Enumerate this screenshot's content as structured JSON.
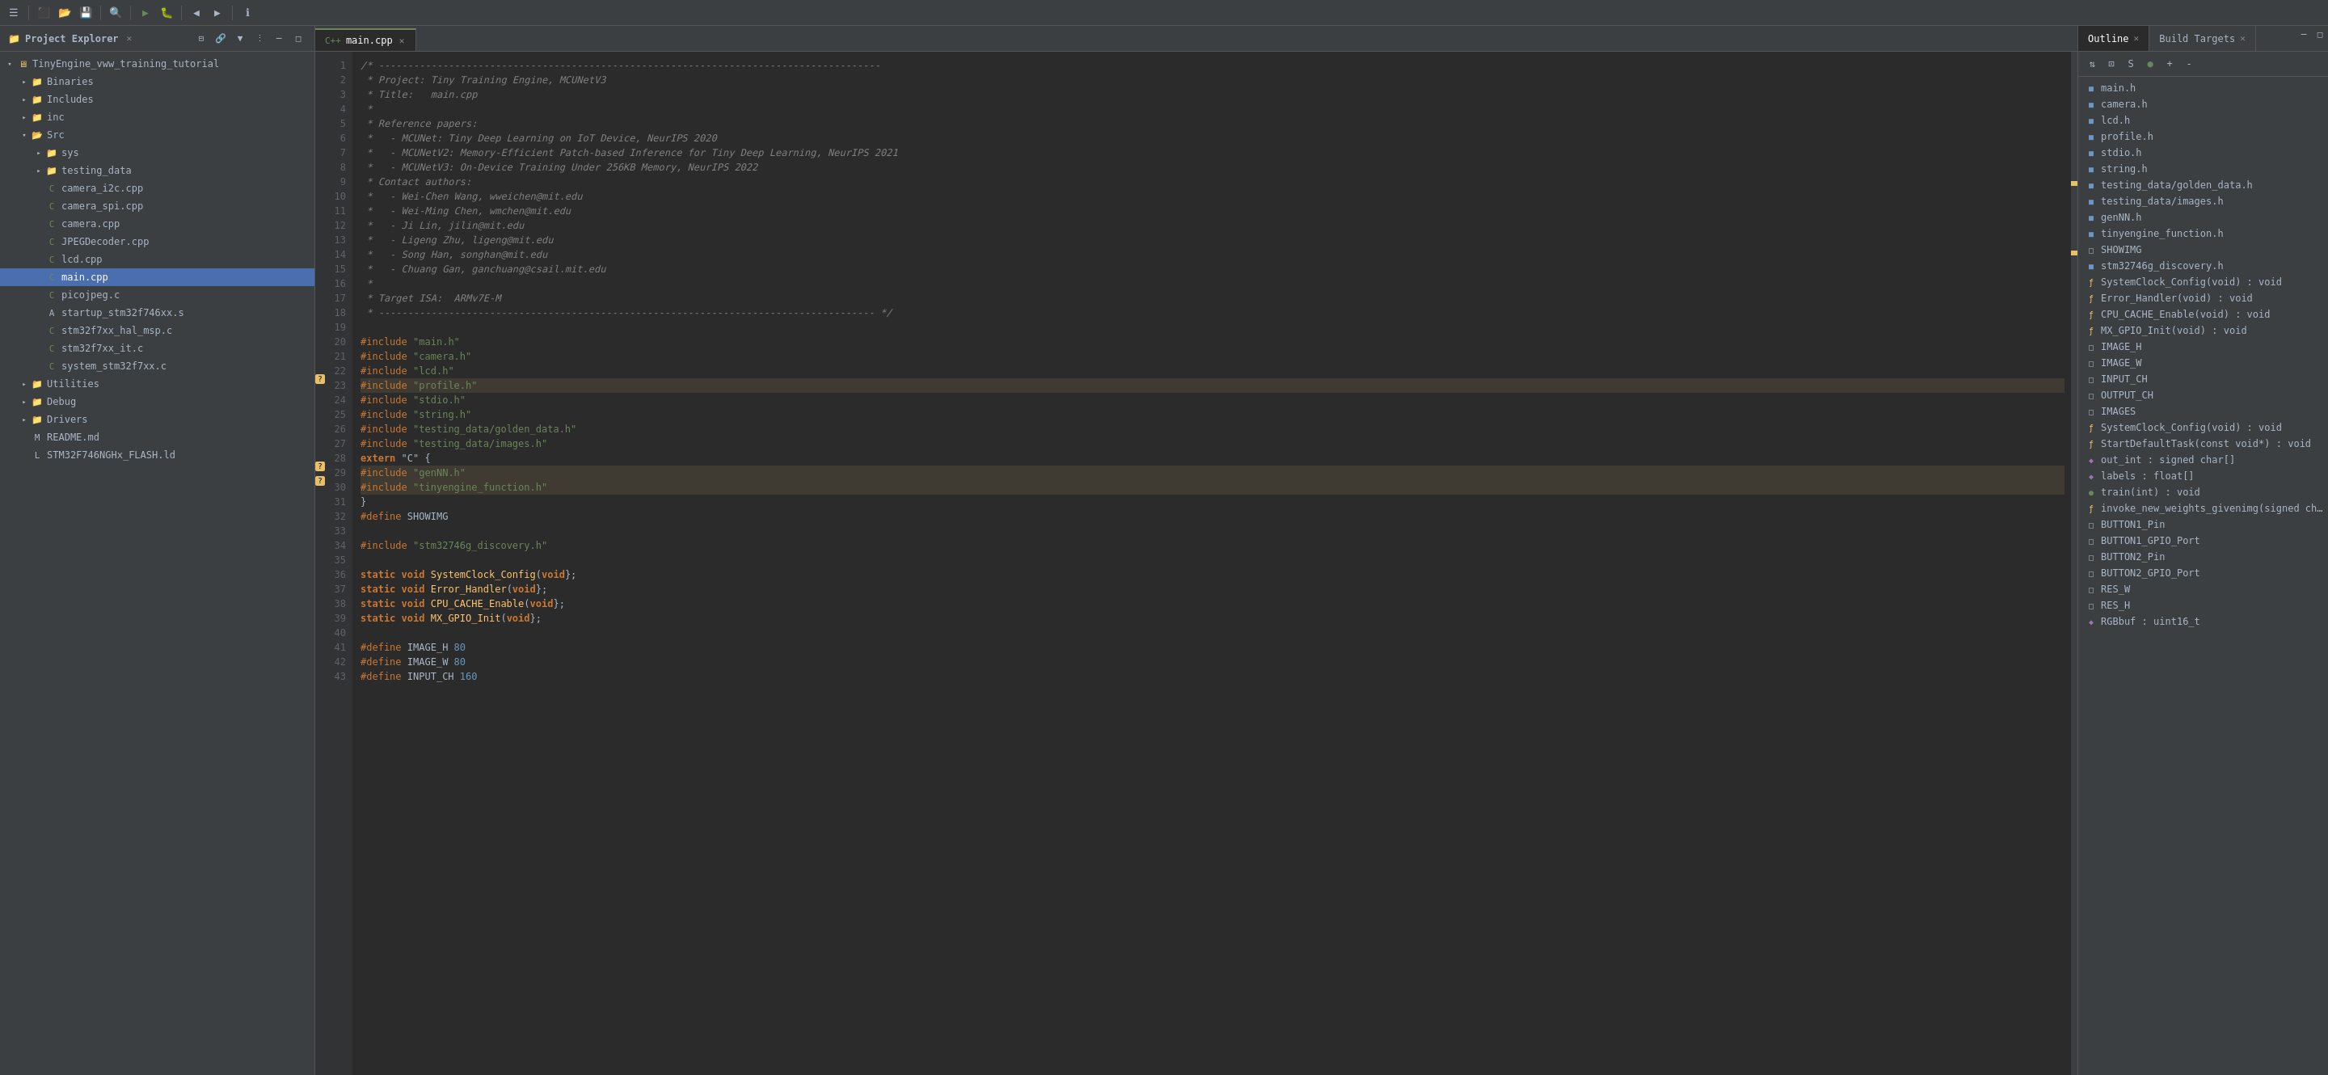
{
  "toolbar": {
    "buttons": [
      "☰",
      "⬛",
      "⬛",
      "⬛",
      "⚙",
      "⬛",
      "⬛",
      "⬛",
      "⬛",
      "⬛",
      "▶",
      "⬛",
      "⬛",
      "⬛",
      "⬛",
      "⬛",
      "⬛",
      "⬛",
      "⬛",
      "⬛",
      "⬛",
      "⬛",
      "⬛",
      "ℹ"
    ]
  },
  "project_explorer": {
    "title": "Project Explorer",
    "items": [
      {
        "id": "root",
        "label": "TinyEngine_vww_training_tutorial",
        "level": 0,
        "type": "project",
        "expanded": true,
        "arrow": "▾"
      },
      {
        "id": "binaries",
        "label": "Binaries",
        "level": 1,
        "type": "folder",
        "expanded": false,
        "arrow": "▸"
      },
      {
        "id": "includes",
        "label": "Includes",
        "level": 1,
        "type": "folder",
        "expanded": false,
        "arrow": "▸"
      },
      {
        "id": "inc",
        "label": "inc",
        "level": 1,
        "type": "folder",
        "expanded": false,
        "arrow": "▸"
      },
      {
        "id": "src",
        "label": "Src",
        "level": 1,
        "type": "folder",
        "expanded": true,
        "arrow": "▾"
      },
      {
        "id": "sys",
        "label": "sys",
        "level": 2,
        "type": "folder",
        "expanded": false,
        "arrow": "▸"
      },
      {
        "id": "testing_data",
        "label": "testing_data",
        "level": 2,
        "type": "folder",
        "expanded": false,
        "arrow": "▸"
      },
      {
        "id": "camera_i2c",
        "label": "camera_i2c.cpp",
        "level": 2,
        "type": "cpp",
        "arrow": ""
      },
      {
        "id": "camera_spi",
        "label": "camera_spi.cpp",
        "level": 2,
        "type": "cpp",
        "arrow": ""
      },
      {
        "id": "camera",
        "label": "camera.cpp",
        "level": 2,
        "type": "cpp",
        "arrow": ""
      },
      {
        "id": "jpegdecoder",
        "label": "JPEGDecoder.cpp",
        "level": 2,
        "type": "cpp",
        "arrow": ""
      },
      {
        "id": "lcd",
        "label": "lcd.cpp",
        "level": 2,
        "type": "cpp",
        "arrow": ""
      },
      {
        "id": "main_cpp",
        "label": "main.cpp",
        "level": 2,
        "type": "cpp",
        "selected": true,
        "arrow": ""
      },
      {
        "id": "picojpeg",
        "label": "picojpeg.c",
        "level": 2,
        "type": "c",
        "arrow": ""
      },
      {
        "id": "startup",
        "label": "startup_stm32f746xx.s",
        "level": 2,
        "type": "asm",
        "arrow": ""
      },
      {
        "id": "stm32f7xx_hal_msp",
        "label": "stm32f7xx_hal_msp.c",
        "level": 2,
        "type": "c",
        "arrow": ""
      },
      {
        "id": "stm32f7xx_it",
        "label": "stm32f7xx_it.c",
        "level": 2,
        "type": "c",
        "arrow": ""
      },
      {
        "id": "system_stm32f7xx",
        "label": "system_stm32f7xx.c",
        "level": 2,
        "type": "c",
        "arrow": ""
      },
      {
        "id": "utilities",
        "label": "Utilities",
        "level": 1,
        "type": "folder",
        "expanded": false,
        "arrow": "▸"
      },
      {
        "id": "debug",
        "label": "Debug",
        "level": 1,
        "type": "folder",
        "expanded": false,
        "arrow": "▸"
      },
      {
        "id": "drivers",
        "label": "Drivers",
        "level": 1,
        "type": "folder",
        "expanded": false,
        "arrow": "▸"
      },
      {
        "id": "readme",
        "label": "README.md",
        "level": 1,
        "type": "md",
        "arrow": ""
      },
      {
        "id": "flash",
        "label": "STM32F746NGHx_FLASH.ld",
        "level": 1,
        "type": "ld",
        "arrow": ""
      }
    ]
  },
  "editor": {
    "tab_label": "main.cpp",
    "lines": [
      {
        "n": 1,
        "tokens": [
          {
            "t": "cm",
            "v": "/* --------------------------------------------------------------------------------------"
          }
        ]
      },
      {
        "n": 2,
        "tokens": [
          {
            "t": "cm",
            "v": " * Project: Tiny Training Engine, MCUNetV3"
          }
        ]
      },
      {
        "n": 3,
        "tokens": [
          {
            "t": "cm",
            "v": " * Title:   main.cpp"
          }
        ]
      },
      {
        "n": 4,
        "tokens": [
          {
            "t": "cm",
            "v": " *"
          }
        ]
      },
      {
        "n": 5,
        "tokens": [
          {
            "t": "cm",
            "v": " * Reference papers:"
          }
        ]
      },
      {
        "n": 6,
        "tokens": [
          {
            "t": "cm",
            "v": " *   - MCUNet: Tiny Deep Learning on IoT Device, NeurIPS 2020"
          }
        ]
      },
      {
        "n": 7,
        "tokens": [
          {
            "t": "cm",
            "v": " *   - MCUNetV2: Memory-Efficient Patch-based Inference for Tiny Deep Learning, NeurIPS 2021"
          }
        ]
      },
      {
        "n": 8,
        "tokens": [
          {
            "t": "cm",
            "v": " *   - MCUNetV3: On-Device Training Under 256KB Memory, NeurIPS 2022"
          }
        ]
      },
      {
        "n": 9,
        "tokens": [
          {
            "t": "cm",
            "v": " * Contact authors:"
          }
        ]
      },
      {
        "n": 10,
        "tokens": [
          {
            "t": "cm",
            "v": " *   - Wei-Chen Wang, wweichen@mit.edu"
          }
        ]
      },
      {
        "n": 11,
        "tokens": [
          {
            "t": "cm",
            "v": " *   - Wei-Ming Chen, wmchen@mit.edu"
          }
        ]
      },
      {
        "n": 12,
        "tokens": [
          {
            "t": "cm",
            "v": " *   - Ji Lin, jilin@mit.edu"
          }
        ]
      },
      {
        "n": 13,
        "tokens": [
          {
            "t": "cm",
            "v": " *   - Ligeng Zhu, ligeng@mit.edu"
          }
        ]
      },
      {
        "n": 14,
        "tokens": [
          {
            "t": "cm",
            "v": " *   - Song Han, songhan@mit.edu"
          }
        ]
      },
      {
        "n": 15,
        "tokens": [
          {
            "t": "cm",
            "v": " *   - Chuang Gan, ganchuang@csail.mit.edu"
          }
        ]
      },
      {
        "n": 16,
        "tokens": [
          {
            "t": "cm",
            "v": " *"
          }
        ]
      },
      {
        "n": 17,
        "tokens": [
          {
            "t": "cm",
            "v": " * Target ISA:  ARMv7E-M"
          }
        ]
      },
      {
        "n": 18,
        "tokens": [
          {
            "t": "cm",
            "v": " * ------------------------------------------------------------------------------------- */"
          }
        ]
      },
      {
        "n": 19,
        "tokens": [
          {
            "t": "plain",
            "v": ""
          }
        ]
      },
      {
        "n": 20,
        "tokens": [
          {
            "t": "pp",
            "v": "#include "
          },
          {
            "t": "str",
            "v": "\"main.h\""
          }
        ]
      },
      {
        "n": 21,
        "tokens": [
          {
            "t": "pp",
            "v": "#include "
          },
          {
            "t": "str",
            "v": "\"camera.h\""
          }
        ]
      },
      {
        "n": 22,
        "tokens": [
          {
            "t": "pp",
            "v": "#include "
          },
          {
            "t": "str",
            "v": "\"lcd.h\""
          }
        ]
      },
      {
        "n": 23,
        "tokens": [
          {
            "t": "pp",
            "v": "#include "
          },
          {
            "t": "str",
            "v": "\"profile.h\""
          }
        ],
        "warning": true
      },
      {
        "n": 24,
        "tokens": [
          {
            "t": "pp",
            "v": "#include "
          },
          {
            "t": "str",
            "v": "\"stdio.h\""
          }
        ]
      },
      {
        "n": 25,
        "tokens": [
          {
            "t": "pp",
            "v": "#include "
          },
          {
            "t": "str",
            "v": "\"string.h\""
          }
        ]
      },
      {
        "n": 26,
        "tokens": [
          {
            "t": "pp",
            "v": "#include "
          },
          {
            "t": "str",
            "v": "\"testing_data/golden_data.h\""
          }
        ]
      },
      {
        "n": 27,
        "tokens": [
          {
            "t": "pp",
            "v": "#include "
          },
          {
            "t": "str",
            "v": "\"testing_data/images.h\""
          }
        ]
      },
      {
        "n": 28,
        "tokens": [
          {
            "t": "kw",
            "v": "extern "
          },
          {
            "t": "plain",
            "v": "\"C\" {"
          }
        ]
      },
      {
        "n": 29,
        "tokens": [
          {
            "t": "pp",
            "v": "#include "
          },
          {
            "t": "str",
            "v": "\"genNN.h\""
          }
        ],
        "warning": true
      },
      {
        "n": 30,
        "tokens": [
          {
            "t": "pp",
            "v": "#include "
          },
          {
            "t": "str",
            "v": "\"tinyengine_function.h\""
          }
        ],
        "warning": true
      },
      {
        "n": 31,
        "tokens": [
          {
            "t": "plain",
            "v": "}"
          }
        ]
      },
      {
        "n": 32,
        "tokens": [
          {
            "t": "pp",
            "v": "#define "
          },
          {
            "t": "plain",
            "v": "SHOWIMG"
          }
        ]
      },
      {
        "n": 33,
        "tokens": [
          {
            "t": "plain",
            "v": ""
          }
        ]
      },
      {
        "n": 34,
        "tokens": [
          {
            "t": "pp",
            "v": "#include "
          },
          {
            "t": "str",
            "v": "\"stm32746g_discovery.h\""
          }
        ]
      },
      {
        "n": 35,
        "tokens": [
          {
            "t": "plain",
            "v": ""
          }
        ]
      },
      {
        "n": 36,
        "tokens": [
          {
            "t": "kw",
            "v": "static "
          },
          {
            "t": "kw",
            "v": "void "
          },
          {
            "t": "fn",
            "v": "SystemClock_Config"
          },
          {
            "t": "plain",
            "v": "("
          },
          {
            "t": "kw",
            "v": "void"
          },
          {
            "t": "plain",
            "v": "};"
          }
        ]
      },
      {
        "n": 37,
        "tokens": [
          {
            "t": "kw",
            "v": "static "
          },
          {
            "t": "kw",
            "v": "void "
          },
          {
            "t": "fn",
            "v": "Error_Handler"
          },
          {
            "t": "plain",
            "v": "("
          },
          {
            "t": "kw",
            "v": "void"
          },
          {
            "t": "plain",
            "v": "};"
          }
        ]
      },
      {
        "n": 38,
        "tokens": [
          {
            "t": "kw",
            "v": "static "
          },
          {
            "t": "kw",
            "v": "void "
          },
          {
            "t": "fn",
            "v": "CPU_CACHE_Enable"
          },
          {
            "t": "plain",
            "v": "("
          },
          {
            "t": "kw",
            "v": "void"
          },
          {
            "t": "plain",
            "v": "};"
          }
        ]
      },
      {
        "n": 39,
        "tokens": [
          {
            "t": "kw",
            "v": "static "
          },
          {
            "t": "kw",
            "v": "void "
          },
          {
            "t": "fn",
            "v": "MX_GPIO_Init"
          },
          {
            "t": "plain",
            "v": "("
          },
          {
            "t": "kw",
            "v": "void"
          },
          {
            "t": "plain",
            "v": "};"
          }
        ]
      },
      {
        "n": 40,
        "tokens": [
          {
            "t": "plain",
            "v": ""
          }
        ]
      },
      {
        "n": 41,
        "tokens": [
          {
            "t": "pp",
            "v": "#define "
          },
          {
            "t": "plain",
            "v": "IMAGE_H "
          },
          {
            "t": "num",
            "v": "80"
          }
        ]
      },
      {
        "n": 42,
        "tokens": [
          {
            "t": "pp",
            "v": "#define "
          },
          {
            "t": "plain",
            "v": "IMAGE_W "
          },
          {
            "t": "num",
            "v": "80"
          }
        ]
      },
      {
        "n": 43,
        "tokens": [
          {
            "t": "pp",
            "v": "#define "
          },
          {
            "t": "plain",
            "v": "INPUT_CH "
          },
          {
            "t": "num",
            "v": "160"
          }
        ]
      }
    ]
  },
  "outline": {
    "title": "Outline",
    "items": [
      {
        "label": "main.h",
        "type": "h",
        "icon": "h"
      },
      {
        "label": "camera.h",
        "type": "h",
        "icon": "h"
      },
      {
        "label": "lcd.h",
        "type": "h",
        "icon": "h"
      },
      {
        "label": "profile.h",
        "type": "h",
        "icon": "h"
      },
      {
        "label": "stdio.h",
        "type": "h",
        "icon": "h"
      },
      {
        "label": "string.h",
        "type": "h",
        "icon": "h"
      },
      {
        "label": "testing_data/golden_data.h",
        "type": "h",
        "icon": "h"
      },
      {
        "label": "testing_data/images.h",
        "type": "h",
        "icon": "h"
      },
      {
        "label": "genNN.h",
        "type": "h",
        "icon": "h"
      },
      {
        "label": "tinyengine_function.h",
        "type": "h",
        "icon": "h"
      },
      {
        "label": "SHOWIMG",
        "type": "const",
        "icon": "const"
      },
      {
        "label": "stm32746g_discovery.h",
        "type": "h",
        "icon": "h"
      },
      {
        "label": "SystemClock_Config(void) : void",
        "type": "fn",
        "icon": "fn"
      },
      {
        "label": "Error_Handler(void) : void",
        "type": "fn",
        "icon": "fn"
      },
      {
        "label": "CPU_CACHE_Enable(void) : void",
        "type": "fn",
        "icon": "fn"
      },
      {
        "label": "MX_GPIO_Init(void) : void",
        "type": "fn",
        "icon": "fn"
      },
      {
        "label": "IMAGE_H",
        "type": "const",
        "icon": "const"
      },
      {
        "label": "IMAGE_W",
        "type": "const",
        "icon": "const"
      },
      {
        "label": "INPUT_CH",
        "type": "const",
        "icon": "const"
      },
      {
        "label": "OUTPUT_CH",
        "type": "const",
        "icon": "const"
      },
      {
        "label": "IMAGES",
        "type": "const",
        "icon": "const"
      },
      {
        "label": "SystemClock_Config(void) : void",
        "type": "fn",
        "icon": "fn"
      },
      {
        "label": "StartDefaultTask(const void*) : void",
        "type": "fn",
        "icon": "fn"
      },
      {
        "label": "out_int : signed char[]",
        "type": "var",
        "icon": "var"
      },
      {
        "label": "labels : float[]",
        "type": "var",
        "icon": "var"
      },
      {
        "label": "train(int) : void",
        "type": "fn",
        "icon": "circle"
      },
      {
        "label": "invoke_new_weights_givenimg(signed ch...",
        "type": "fn",
        "icon": "fn"
      },
      {
        "label": "BUTTON1_Pin",
        "type": "const",
        "icon": "const"
      },
      {
        "label": "BUTTON1_GPIO_Port",
        "type": "const",
        "icon": "const"
      },
      {
        "label": "BUTTON2_Pin",
        "type": "const",
        "icon": "const"
      },
      {
        "label": "BUTTON2_GPIO_Port",
        "type": "const",
        "icon": "const"
      },
      {
        "label": "RES_W",
        "type": "const",
        "icon": "const"
      },
      {
        "label": "RES_H",
        "type": "const",
        "icon": "const"
      },
      {
        "label": "RGBbuf : uint16_t",
        "type": "var",
        "icon": "var"
      }
    ]
  },
  "build_targets": {
    "title": "Build Targets"
  }
}
